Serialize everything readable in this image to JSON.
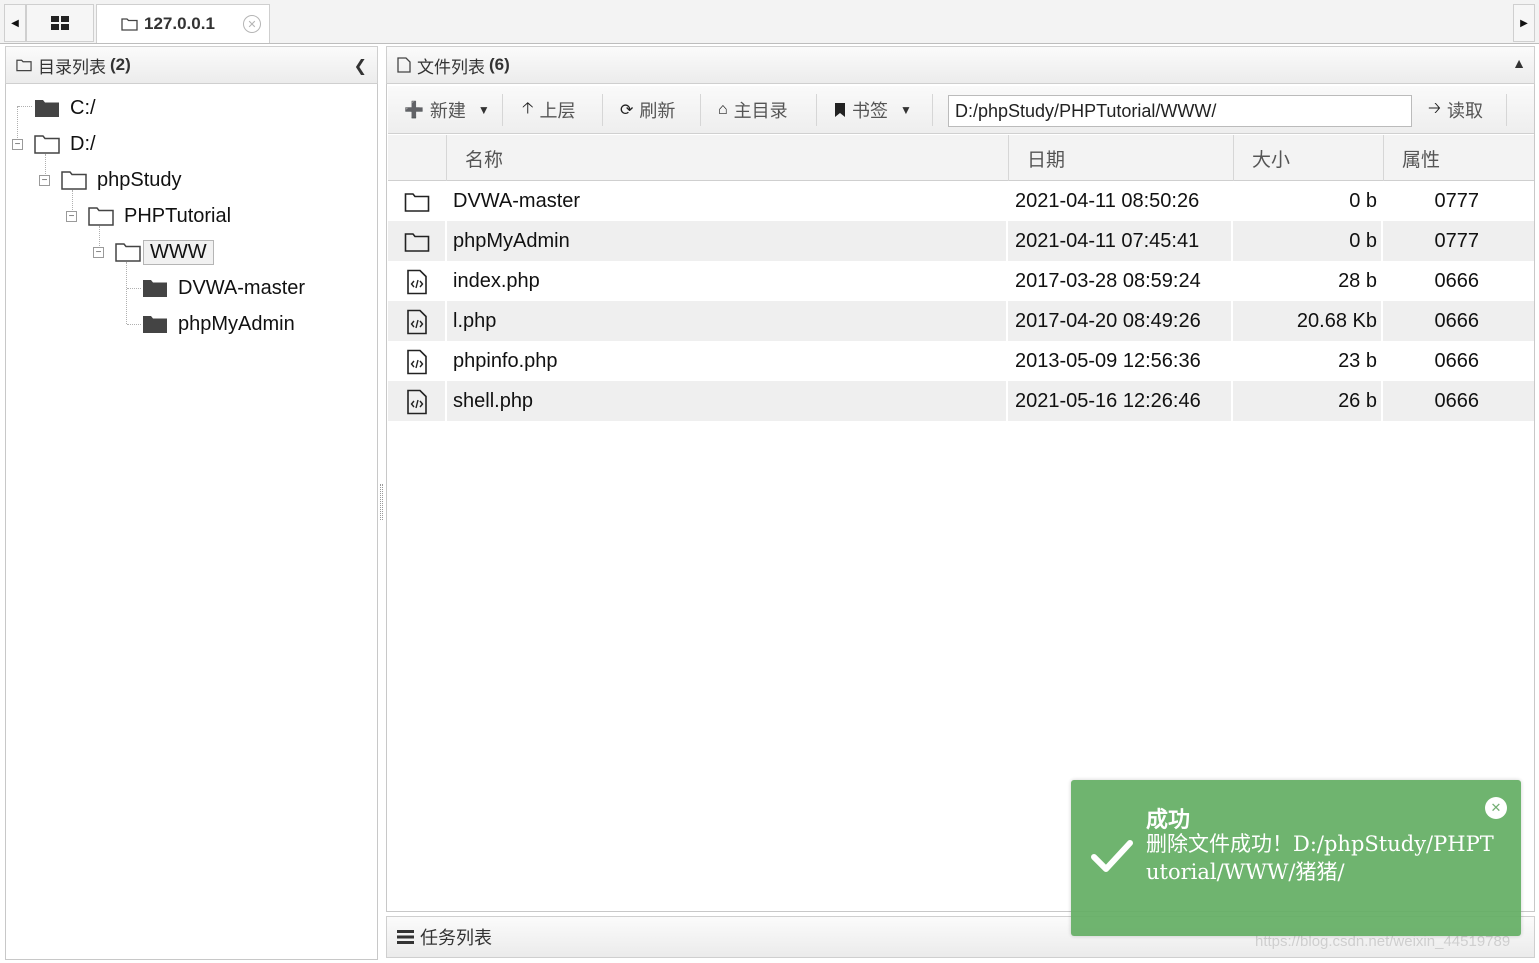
{
  "tabs": {
    "host_label": "127.0.0.1"
  },
  "left_panel": {
    "title": "目录列表",
    "count": "(2)"
  },
  "tree": [
    {
      "label": "C:/",
      "depth": 0,
      "expanded": false,
      "filled": true
    },
    {
      "label": "D:/",
      "depth": 0,
      "expanded": true,
      "filled": false
    },
    {
      "label": "phpStudy",
      "depth": 1,
      "expanded": true,
      "filled": false
    },
    {
      "label": "PHPTutorial",
      "depth": 2,
      "expanded": true,
      "filled": false
    },
    {
      "label": "WWW",
      "depth": 3,
      "expanded": true,
      "filled": false,
      "selected": true
    },
    {
      "label": "DVWA-master",
      "depth": 4,
      "filled": true
    },
    {
      "label": "phpMyAdmin",
      "depth": 4,
      "filled": true
    }
  ],
  "right_panel": {
    "title": "文件列表",
    "count": "(6)"
  },
  "toolbar": {
    "new_label": "新建",
    "up_label": "上层",
    "refresh_label": "刷新",
    "home_label": "主目录",
    "bookmark_label": "书签",
    "path_value": "D:/phpStudy/PHPTutorial/WWW/",
    "read_label": "读取"
  },
  "table": {
    "headers": {
      "name": "名称",
      "date": "日期",
      "size": "大小",
      "attr": "属性"
    },
    "rows": [
      {
        "type": "folder",
        "name": "DVWA-master",
        "date": "2021-04-11 08:50:26",
        "size": "0 b",
        "attr": "0777"
      },
      {
        "type": "folder",
        "name": "phpMyAdmin",
        "date": "2021-04-11 07:45:41",
        "size": "0 b",
        "attr": "0777"
      },
      {
        "type": "code",
        "name": "index.php",
        "date": "2017-03-28 08:59:24",
        "size": "28 b",
        "attr": "0666"
      },
      {
        "type": "code",
        "name": "l.php",
        "date": "2017-04-20 08:49:26",
        "size": "20.68 Kb",
        "attr": "0666"
      },
      {
        "type": "code",
        "name": "phpinfo.php",
        "date": "2013-05-09 12:56:36",
        "size": "23 b",
        "attr": "0666"
      },
      {
        "type": "code",
        "name": "shell.php",
        "date": "2021-05-16 12:26:46",
        "size": "26 b",
        "attr": "0666"
      }
    ]
  },
  "taskbar": {
    "title": "任务列表"
  },
  "toast": {
    "title": "成功",
    "message": "删除文件成功！D:/phpStudy/PHPTutorial/WWW/猪猪/",
    "color": "#65af65"
  },
  "watermark": "https://blog.csdn.net/weixin_44519789"
}
